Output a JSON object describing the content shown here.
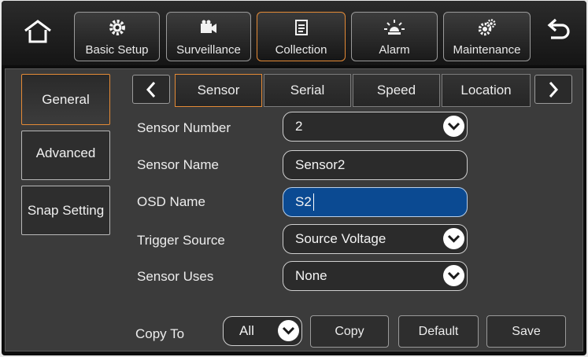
{
  "top_tabs": [
    {
      "label": "Basic Setup",
      "icon": "gear-icon",
      "active": false
    },
    {
      "label": "Surveillance",
      "icon": "camera-icon",
      "active": false
    },
    {
      "label": "Collection",
      "icon": "document-icon",
      "active": true
    },
    {
      "label": "Alarm",
      "icon": "alarm-light-icon",
      "active": false
    },
    {
      "label": "Maintenance",
      "icon": "maintenance-gears-icon",
      "active": false
    }
  ],
  "side_menu": [
    {
      "label": "General",
      "active": true
    },
    {
      "label": "Advanced",
      "active": false
    },
    {
      "label": "Snap Setting",
      "active": false
    }
  ],
  "sub_tabs": [
    {
      "label": "Sensor",
      "active": true
    },
    {
      "label": "Serial",
      "active": false
    },
    {
      "label": "Speed",
      "active": false
    },
    {
      "label": "Location",
      "active": false
    }
  ],
  "form": {
    "sensor_number": {
      "label": "Sensor Number",
      "value": "2"
    },
    "sensor_name": {
      "label": "Sensor Name",
      "value": "Sensor2"
    },
    "osd_name": {
      "label": "OSD Name",
      "value": "S2"
    },
    "trigger_source": {
      "label": "Trigger Source",
      "value": "Source Voltage"
    },
    "sensor_uses": {
      "label": "Sensor Uses",
      "value": "None"
    }
  },
  "footer": {
    "copy_to_label": "Copy To",
    "copy_to_value": "All",
    "copy_button": "Copy",
    "default_button": "Default",
    "save_button": "Save"
  },
  "colors": {
    "accent": "#e48a36",
    "focus_field": "#0b4a92",
    "panel": "#3b3b3b"
  }
}
